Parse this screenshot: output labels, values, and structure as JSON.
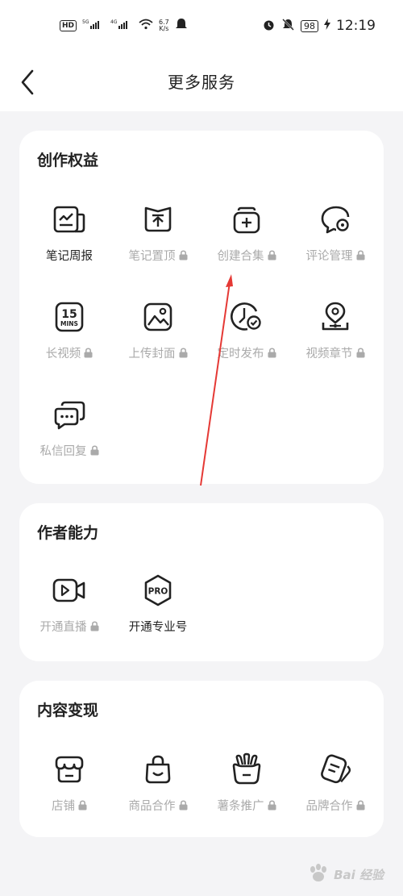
{
  "status_bar": {
    "left": {
      "hd": "HD",
      "speed_value": "6.7",
      "speed_unit": "K/s"
    },
    "right": {
      "battery": "98",
      "time": "12:19"
    }
  },
  "header": {
    "back_icon": "chevron-left-icon",
    "title": "更多服务"
  },
  "sections": [
    {
      "title": "创作权益",
      "items": [
        {
          "label": "笔记周报",
          "icon": "report-icon",
          "locked": false
        },
        {
          "label": "笔记置顶",
          "icon": "pin-top-icon",
          "locked": true
        },
        {
          "label": "创建合集",
          "icon": "collection-add-icon",
          "locked": true
        },
        {
          "label": "评论管理",
          "icon": "comment-settings-icon",
          "locked": true
        },
        {
          "label": "长视频",
          "icon": "long-video-15mins-icon",
          "locked": true,
          "icon_text_top": "15",
          "icon_text_bottom": "MINS"
        },
        {
          "label": "上传封面",
          "icon": "image-upload-icon",
          "locked": true
        },
        {
          "label": "定时发布",
          "icon": "scheduled-publish-icon",
          "locked": true
        },
        {
          "label": "视频章节",
          "icon": "video-chapter-icon",
          "locked": true
        },
        {
          "label": "私信回复",
          "icon": "message-reply-icon",
          "locked": true
        }
      ]
    },
    {
      "title": "作者能力",
      "items": [
        {
          "label": "开通直播",
          "icon": "live-video-icon",
          "locked": true
        },
        {
          "label": "开通专业号",
          "icon": "pro-badge-icon",
          "locked": false,
          "icon_text": "PRO"
        }
      ]
    },
    {
      "title": "内容变现",
      "items": [
        {
          "label": "店铺",
          "icon": "shop-icon",
          "locked": true
        },
        {
          "label": "商品合作",
          "icon": "shopping-bag-icon",
          "locked": true
        },
        {
          "label": "薯条推广",
          "icon": "fries-promotion-icon",
          "locked": true
        },
        {
          "label": "品牌合作",
          "icon": "brand-tag-icon",
          "locked": true
        }
      ]
    }
  ],
  "colors": {
    "background": "#f4f4f6",
    "card": "#ffffff",
    "text_active": "#222222",
    "text_locked": "#aaaaaa",
    "annotation_arrow": "#e53935"
  },
  "watermark": {
    "text": "Bai 经验"
  }
}
